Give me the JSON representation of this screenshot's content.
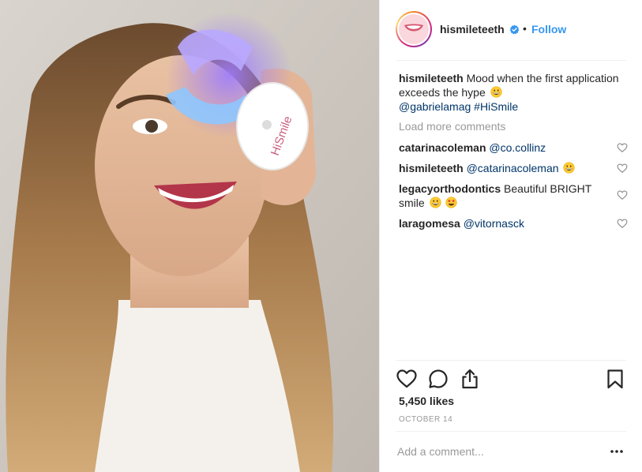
{
  "post": {
    "username": "hismileteeth",
    "follow_label": "Follow",
    "separator": "•",
    "verified": true,
    "caption": {
      "username": "hismileteeth",
      "text": "Mood when the first application exceeds the hype",
      "mention": "@gabrielamag",
      "hashtag": "#HiSmile"
    },
    "load_more_label": "Load more comments",
    "comments": [
      {
        "username": "catarinacoleman",
        "text": "@co.collinz"
      },
      {
        "username": "hismileteeth",
        "text": "@catarinacoleman"
      },
      {
        "username": "legacyorthodontics",
        "text": "Beautiful BRIGHT smile"
      },
      {
        "username": "laragomesa",
        "text": "@vitornasck"
      }
    ],
    "likes": "5,450 likes",
    "date": "OCTOBER 14",
    "add_comment_placeholder": "Add a comment..."
  },
  "colors": {
    "link_blue": "#3897f0",
    "tag_navy": "#003569",
    "muted_gray": "#999999",
    "text_dark": "#262626",
    "divider": "#efefef"
  },
  "icons": [
    "verified-badge-icon",
    "heart-icon",
    "comment-icon",
    "share-icon",
    "bookmark-icon",
    "more-options-icon",
    "grinning-emoji-icon",
    "star-struck-emoji-icon"
  ]
}
